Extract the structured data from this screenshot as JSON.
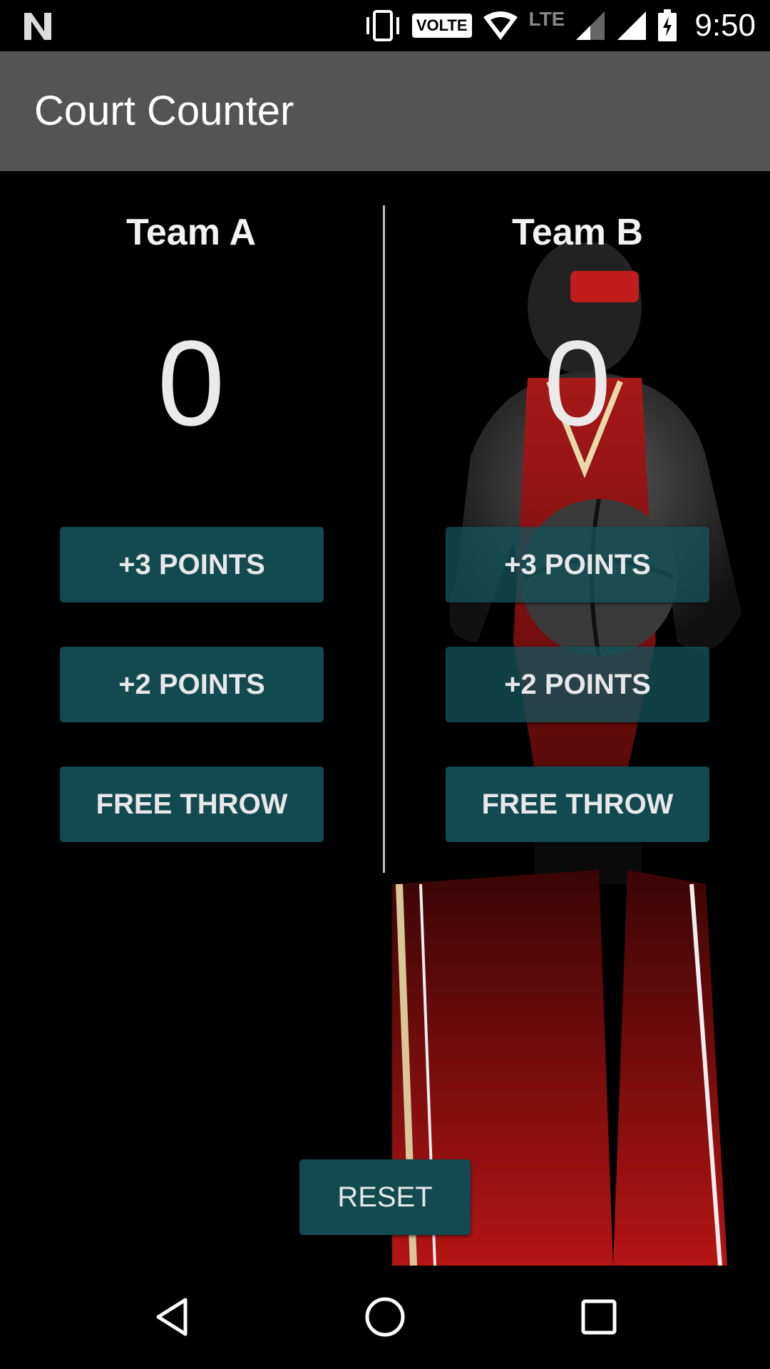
{
  "status_bar": {
    "time": "9:50",
    "volte_label": "VOLTE",
    "lte_label": "LTE",
    "icons": [
      "n-logo-icon",
      "vibrate-icon",
      "volte-icon",
      "wifi-icon",
      "signal-icon",
      "signal-icon",
      "battery-charging-icon"
    ]
  },
  "app_bar": {
    "title": "Court Counter"
  },
  "team_a": {
    "name": "Team A",
    "score": "0",
    "btn_three": "+3 POINTS",
    "btn_two": "+2 POINTS",
    "btn_free": "FREE THROW"
  },
  "team_b": {
    "name": "Team B",
    "score": "0",
    "btn_three": "+3 POINTS",
    "btn_two": "+2 POINTS",
    "btn_free": "FREE THROW"
  },
  "reset_label": "RESET",
  "nav_bar": {
    "icons": [
      "back-icon",
      "home-icon",
      "recents-icon"
    ]
  },
  "colors": {
    "button": "#134a51",
    "app_bar": "#545454",
    "background": "#000000"
  }
}
